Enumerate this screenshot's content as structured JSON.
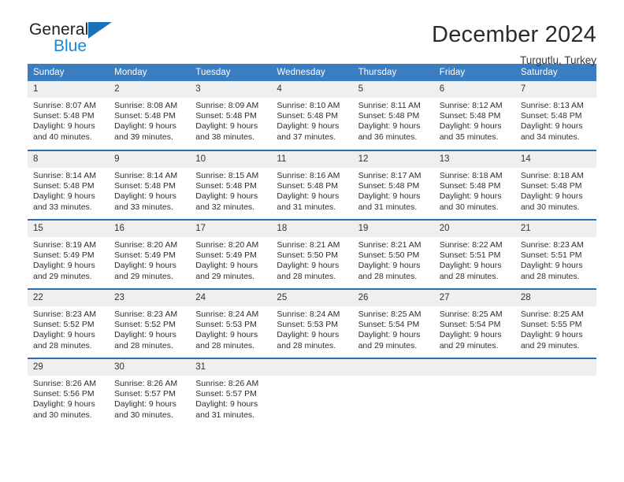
{
  "brand": {
    "name_top": "General",
    "name_bottom": "Blue",
    "mark": "triangle-logo",
    "color_top": "#231f20",
    "color_bottom": "#1a86d6"
  },
  "header": {
    "title": "December 2024",
    "subtitle": "Turgutlu, Turkey"
  },
  "theme": {
    "header_blue": "#3a7dc0",
    "rule_blue": "#2b6cad",
    "daynum_band": "#efefef"
  },
  "calendar": {
    "weekday_headers": [
      "Sunday",
      "Monday",
      "Tuesday",
      "Wednesday",
      "Thursday",
      "Friday",
      "Saturday"
    ],
    "weeks": [
      [
        {
          "day": "1",
          "sunrise": "Sunrise: 8:07 AM",
          "sunset": "Sunset: 5:48 PM",
          "daylight": "Daylight: 9 hours and 40 minutes."
        },
        {
          "day": "2",
          "sunrise": "Sunrise: 8:08 AM",
          "sunset": "Sunset: 5:48 PM",
          "daylight": "Daylight: 9 hours and 39 minutes."
        },
        {
          "day": "3",
          "sunrise": "Sunrise: 8:09 AM",
          "sunset": "Sunset: 5:48 PM",
          "daylight": "Daylight: 9 hours and 38 minutes."
        },
        {
          "day": "4",
          "sunrise": "Sunrise: 8:10 AM",
          "sunset": "Sunset: 5:48 PM",
          "daylight": "Daylight: 9 hours and 37 minutes."
        },
        {
          "day": "5",
          "sunrise": "Sunrise: 8:11 AM",
          "sunset": "Sunset: 5:48 PM",
          "daylight": "Daylight: 9 hours and 36 minutes."
        },
        {
          "day": "6",
          "sunrise": "Sunrise: 8:12 AM",
          "sunset": "Sunset: 5:48 PM",
          "daylight": "Daylight: 9 hours and 35 minutes."
        },
        {
          "day": "7",
          "sunrise": "Sunrise: 8:13 AM",
          "sunset": "Sunset: 5:48 PM",
          "daylight": "Daylight: 9 hours and 34 minutes."
        }
      ],
      [
        {
          "day": "8",
          "sunrise": "Sunrise: 8:14 AM",
          "sunset": "Sunset: 5:48 PM",
          "daylight": "Daylight: 9 hours and 33 minutes."
        },
        {
          "day": "9",
          "sunrise": "Sunrise: 8:14 AM",
          "sunset": "Sunset: 5:48 PM",
          "daylight": "Daylight: 9 hours and 33 minutes."
        },
        {
          "day": "10",
          "sunrise": "Sunrise: 8:15 AM",
          "sunset": "Sunset: 5:48 PM",
          "daylight": "Daylight: 9 hours and 32 minutes."
        },
        {
          "day": "11",
          "sunrise": "Sunrise: 8:16 AM",
          "sunset": "Sunset: 5:48 PM",
          "daylight": "Daylight: 9 hours and 31 minutes."
        },
        {
          "day": "12",
          "sunrise": "Sunrise: 8:17 AM",
          "sunset": "Sunset: 5:48 PM",
          "daylight": "Daylight: 9 hours and 31 minutes."
        },
        {
          "day": "13",
          "sunrise": "Sunrise: 8:18 AM",
          "sunset": "Sunset: 5:48 PM",
          "daylight": "Daylight: 9 hours and 30 minutes."
        },
        {
          "day": "14",
          "sunrise": "Sunrise: 8:18 AM",
          "sunset": "Sunset: 5:48 PM",
          "daylight": "Daylight: 9 hours and 30 minutes."
        }
      ],
      [
        {
          "day": "15",
          "sunrise": "Sunrise: 8:19 AM",
          "sunset": "Sunset: 5:49 PM",
          "daylight": "Daylight: 9 hours and 29 minutes."
        },
        {
          "day": "16",
          "sunrise": "Sunrise: 8:20 AM",
          "sunset": "Sunset: 5:49 PM",
          "daylight": "Daylight: 9 hours and 29 minutes."
        },
        {
          "day": "17",
          "sunrise": "Sunrise: 8:20 AM",
          "sunset": "Sunset: 5:49 PM",
          "daylight": "Daylight: 9 hours and 29 minutes."
        },
        {
          "day": "18",
          "sunrise": "Sunrise: 8:21 AM",
          "sunset": "Sunset: 5:50 PM",
          "daylight": "Daylight: 9 hours and 28 minutes."
        },
        {
          "day": "19",
          "sunrise": "Sunrise: 8:21 AM",
          "sunset": "Sunset: 5:50 PM",
          "daylight": "Daylight: 9 hours and 28 minutes."
        },
        {
          "day": "20",
          "sunrise": "Sunrise: 8:22 AM",
          "sunset": "Sunset: 5:51 PM",
          "daylight": "Daylight: 9 hours and 28 minutes."
        },
        {
          "day": "21",
          "sunrise": "Sunrise: 8:23 AM",
          "sunset": "Sunset: 5:51 PM",
          "daylight": "Daylight: 9 hours and 28 minutes."
        }
      ],
      [
        {
          "day": "22",
          "sunrise": "Sunrise: 8:23 AM",
          "sunset": "Sunset: 5:52 PM",
          "daylight": "Daylight: 9 hours and 28 minutes."
        },
        {
          "day": "23",
          "sunrise": "Sunrise: 8:23 AM",
          "sunset": "Sunset: 5:52 PM",
          "daylight": "Daylight: 9 hours and 28 minutes."
        },
        {
          "day": "24",
          "sunrise": "Sunrise: 8:24 AM",
          "sunset": "Sunset: 5:53 PM",
          "daylight": "Daylight: 9 hours and 28 minutes."
        },
        {
          "day": "25",
          "sunrise": "Sunrise: 8:24 AM",
          "sunset": "Sunset: 5:53 PM",
          "daylight": "Daylight: 9 hours and 28 minutes."
        },
        {
          "day": "26",
          "sunrise": "Sunrise: 8:25 AM",
          "sunset": "Sunset: 5:54 PM",
          "daylight": "Daylight: 9 hours and 29 minutes."
        },
        {
          "day": "27",
          "sunrise": "Sunrise: 8:25 AM",
          "sunset": "Sunset: 5:54 PM",
          "daylight": "Daylight: 9 hours and 29 minutes."
        },
        {
          "day": "28",
          "sunrise": "Sunrise: 8:25 AM",
          "sunset": "Sunset: 5:55 PM",
          "daylight": "Daylight: 9 hours and 29 minutes."
        }
      ],
      [
        {
          "day": "29",
          "sunrise": "Sunrise: 8:26 AM",
          "sunset": "Sunset: 5:56 PM",
          "daylight": "Daylight: 9 hours and 30 minutes."
        },
        {
          "day": "30",
          "sunrise": "Sunrise: 8:26 AM",
          "sunset": "Sunset: 5:57 PM",
          "daylight": "Daylight: 9 hours and 30 minutes."
        },
        {
          "day": "31",
          "sunrise": "Sunrise: 8:26 AM",
          "sunset": "Sunset: 5:57 PM",
          "daylight": "Daylight: 9 hours and 31 minutes."
        },
        {
          "day": "",
          "sunrise": "",
          "sunset": "",
          "daylight": ""
        },
        {
          "day": "",
          "sunrise": "",
          "sunset": "",
          "daylight": ""
        },
        {
          "day": "",
          "sunrise": "",
          "sunset": "",
          "daylight": ""
        },
        {
          "day": "",
          "sunrise": "",
          "sunset": "",
          "daylight": ""
        }
      ]
    ]
  }
}
